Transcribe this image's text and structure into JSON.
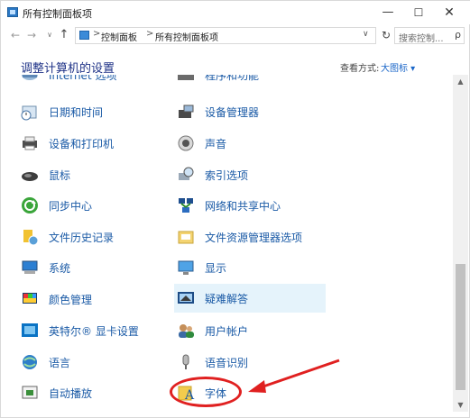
{
  "window": {
    "title": "所有控制面板项",
    "controls": {
      "minimize": "—",
      "maximize": "☐",
      "close": "✕"
    }
  },
  "address_bar": {
    "crumbs": [
      "控制面板",
      "所有控制面板项"
    ],
    "separator": ">",
    "search_placeholder": "搜索控制...",
    "search_icon": "ρ",
    "refresh_icon": "↻",
    "dropdown_icon": "∨"
  },
  "content": {
    "heading": "调整计算机的设置",
    "view_by_label": "查看方式:",
    "view_by_value": "大图标 ▾"
  },
  "partial_top_items": [
    "Internet 选项",
    "程序和功能"
  ],
  "left_items": [
    {
      "label": "日期和时间",
      "icon": "datetime-icon"
    },
    {
      "label": "设备和打印机",
      "icon": "printer-icon"
    },
    {
      "label": "鼠标",
      "icon": "mouse-icon"
    },
    {
      "label": "同步中心",
      "icon": "sync-icon"
    },
    {
      "label": "文件历史记录",
      "icon": "file-history-icon"
    },
    {
      "label": "系统",
      "icon": "system-icon"
    },
    {
      "label": "颜色管理",
      "icon": "color-management-icon"
    },
    {
      "label": "英特尔® 显卡设置",
      "icon": "intel-graphics-icon"
    },
    {
      "label": "语言",
      "icon": "language-icon"
    },
    {
      "label": "自动播放",
      "icon": "autoplay-icon"
    }
  ],
  "right_items": [
    {
      "label": "设备管理器",
      "icon": "device-manager-icon"
    },
    {
      "label": "声音",
      "icon": "sound-icon"
    },
    {
      "label": "索引选项",
      "icon": "indexing-icon"
    },
    {
      "label": "网络和共享中心",
      "icon": "network-icon"
    },
    {
      "label": "文件资源管理器选项",
      "icon": "folder-options-icon"
    },
    {
      "label": "显示",
      "icon": "display-icon"
    },
    {
      "label": "疑难解答",
      "icon": "troubleshooting-icon"
    },
    {
      "label": "用户帐户",
      "icon": "user-accounts-icon"
    },
    {
      "label": "语音识别",
      "icon": "speech-recognition-icon"
    },
    {
      "label": "字体",
      "icon": "fonts-icon"
    }
  ],
  "colors": {
    "link": "#1a5aa6",
    "heading": "#1e3287",
    "highlight": "#e5f3fb",
    "annotation": "#e02020"
  }
}
